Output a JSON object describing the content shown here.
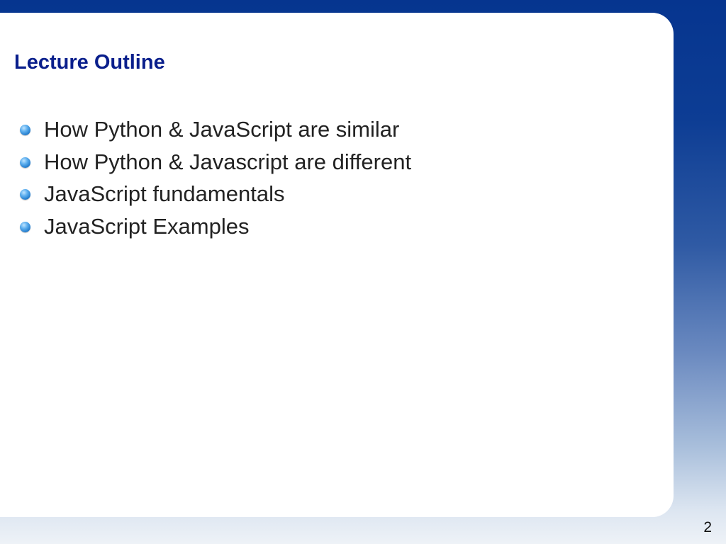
{
  "slide": {
    "title": "Lecture Outline",
    "bullets": [
      "How Python & JavaScript are similar",
      "How Python & Javascript are different",
      "JavaScript fundamentals",
      "JavaScript Examples"
    ],
    "page_number": "2"
  },
  "colors": {
    "title": "#0a1f8c",
    "bullet": "#1f78c9",
    "background_top": "#06358f",
    "background_bottom": "#eef2f7"
  }
}
